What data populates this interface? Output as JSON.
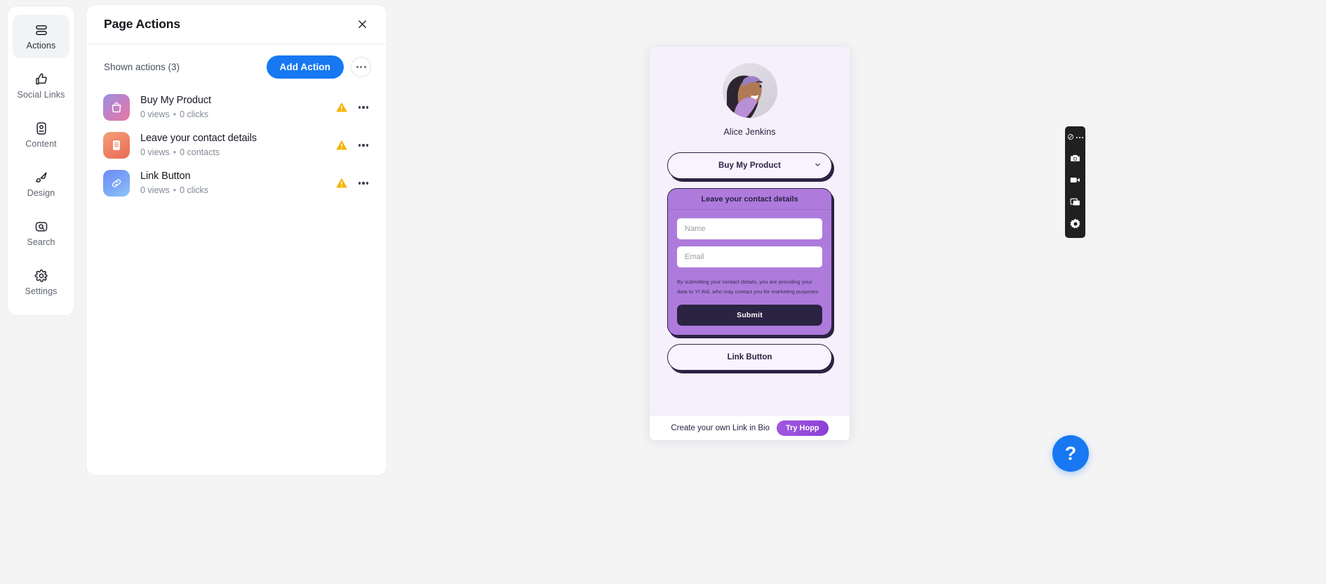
{
  "sidebar": {
    "items": [
      {
        "label": "Actions",
        "icon": "actions-icon",
        "active": true
      },
      {
        "label": "Social Links",
        "icon": "thumbs-up-icon",
        "active": false
      },
      {
        "label": "Content",
        "icon": "content-id-icon",
        "active": false
      },
      {
        "label": "Design",
        "icon": "paintbrush-icon",
        "active": false
      },
      {
        "label": "Search",
        "icon": "search-icon",
        "active": false
      },
      {
        "label": "Settings",
        "icon": "gear-icon",
        "active": false
      }
    ]
  },
  "panel": {
    "title": "Page Actions",
    "shown_label": "Shown actions (3)",
    "add_button": "Add Action",
    "actions": [
      {
        "title": "Buy My Product",
        "meta_views": "0 views",
        "meta_second": "0 clicks",
        "icon": "shopping-bag-icon"
      },
      {
        "title": "Leave your contact details",
        "meta_views": "0 views",
        "meta_second": "0 contacts",
        "icon": "form-icon"
      },
      {
        "title": "Link Button",
        "meta_views": "0 views",
        "meta_second": "0 clicks",
        "icon": "link-icon"
      }
    ]
  },
  "preview": {
    "profile_name": "Alice Jenkins",
    "product_button": "Buy My Product",
    "form": {
      "heading": "Leave your contact details",
      "name_placeholder": "Name",
      "email_placeholder": "Email",
      "name_value": "",
      "email_value": "",
      "consent": "By submitting your contact details, you are providing your data to Yt Wd, who may contact you for marketing purposes.",
      "submit_label": "Submit"
    },
    "link_button": "Link Button",
    "footer_text": "Create your own Link in Bio",
    "footer_cta": "Try Hopp"
  },
  "floatbar": {
    "items": [
      "logo-icon",
      "overflow-dots-icon",
      "camera-icon",
      "video-camera-icon",
      "window-icon",
      "gear-icon"
    ]
  },
  "help": {
    "glyph": "?"
  },
  "colors": {
    "accent_blue": "#1778f2",
    "warning_amber": "#f5b400",
    "preview_bg": "#f6f0fd",
    "form_purple": "#ae7bdd",
    "ink": "#2b2342"
  }
}
